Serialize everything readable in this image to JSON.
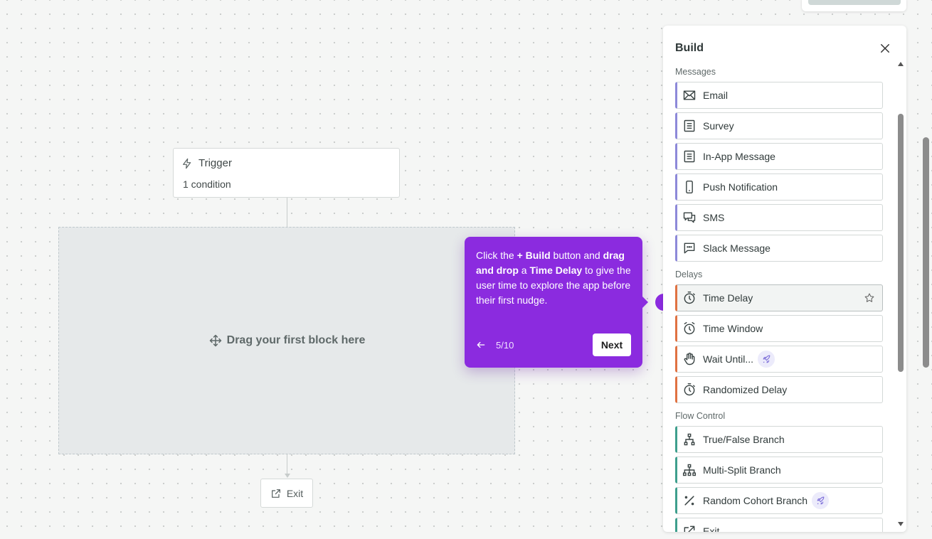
{
  "canvas": {
    "trigger": {
      "title": "Trigger",
      "subtitle": "1 condition"
    },
    "dropzone": {
      "label": "Drag your first block here"
    },
    "exit": {
      "label": "Exit"
    }
  },
  "tooltip": {
    "text_parts": {
      "p1": "Click the ",
      "b1": "+ Build",
      "p2": " button and ",
      "b2": "drag and drop",
      "p3": " a ",
      "b3": "Time Delay",
      "p4": " to give the user time to explore the app before their first nudge."
    },
    "step": "5/10",
    "next_label": "Next"
  },
  "panel": {
    "title": "Build",
    "sections": {
      "messages": "Messages",
      "delays": "Delays",
      "flow_control": "Flow Control"
    },
    "items": {
      "email": "Email",
      "survey": "Survey",
      "in_app": "In-App Message",
      "push": "Push Notification",
      "sms": "SMS",
      "slack": "Slack Message",
      "time_delay": "Time Delay",
      "time_window": "Time Window",
      "wait_until": "Wait Until...",
      "randomized_delay": "Randomized Delay",
      "true_false": "True/False Branch",
      "multi_split": "Multi-Split Branch",
      "random_cohort": "Random Cohort Branch",
      "exit": "Exit"
    }
  },
  "colors": {
    "accent_purple": "#8b2bdf",
    "message_border": "#8d89d9",
    "delay_border": "#e07242",
    "flow_border": "#3e9f8d"
  }
}
